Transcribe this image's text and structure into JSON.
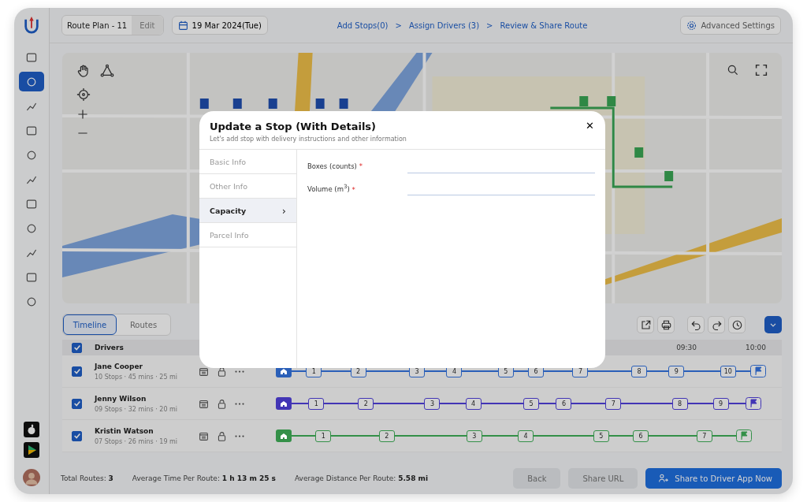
{
  "top_bar": {
    "route_plan": "Route Plan - 11",
    "edit": "Edit",
    "date": "19 Mar 2024(Tue)",
    "steps": [
      {
        "label": "Add Stops(0)",
        "separator": ">"
      },
      {
        "label": "Assign Drivers (3)",
        "separator": ">"
      },
      {
        "label": "Review & Share Route"
      }
    ],
    "advanced": "Advanced Settings"
  },
  "sidebar": {
    "items": [
      {
        "selected": false
      },
      {
        "selected": true
      },
      {
        "selected": false
      },
      {
        "selected": false
      },
      {
        "selected": false
      },
      {
        "selected": false
      },
      {
        "selected": false
      },
      {
        "selected": false
      },
      {
        "selected": false
      },
      {
        "selected": false
      },
      {
        "selected": false
      }
    ]
  },
  "map": {
    "kind": "picture"
  },
  "view_tabs": [
    {
      "label": "Timeline",
      "selected": true
    },
    {
      "label": "Routes",
      "selected": false
    }
  ],
  "drivers_header": {
    "label": "Drivers",
    "checked": true
  },
  "time_labels": [
    "09:30",
    "10:00"
  ],
  "drivers": [
    {
      "name": "Jane Cooper",
      "summary": "10 Stops  · 45 mins  · 25 mi",
      "checked": true,
      "color": "#2a5fb8",
      "stops": [
        "1",
        "2",
        "3",
        "4",
        "5",
        "6",
        "7",
        "8",
        "9",
        "10"
      ]
    },
    {
      "name": "Jenny Wilson",
      "summary": "09 Stops  · 32 mins  · 20 mi",
      "checked": true,
      "color": "#4235b5",
      "stops": [
        "1",
        "2",
        "3",
        "4",
        "5",
        "6",
        "7",
        "8",
        "9"
      ]
    },
    {
      "name": "Kristin Watson",
      "summary": "07 Stops  · 26 mins  · 19 mi",
      "checked": true,
      "color": "#349048",
      "stops": [
        "1",
        "2",
        "3",
        "4",
        "5",
        "6",
        "7"
      ]
    }
  ],
  "footer": {
    "stats": [
      {
        "label": "Total Routes:",
        "value": "3"
      },
      {
        "label": "Average Time Per Route:",
        "value": "1 h 13 m 25 s"
      },
      {
        "label": "Average Distance Per Route:",
        "value": "5.58 mi"
      }
    ],
    "buttons": [
      {
        "label": "Back",
        "kind": "secondary"
      },
      {
        "label": "Share URL",
        "kind": "secondary"
      },
      {
        "label": "Share to Driver App Now",
        "kind": "primary"
      }
    ]
  },
  "modal": {
    "title": "Update a Stop (With Details)",
    "subtitle": "Let's add stop with delivery instructions and other information",
    "close": "✕",
    "sections": [
      {
        "label": "Basic Info",
        "selected": false
      },
      {
        "label": "Other Info",
        "selected": false
      },
      {
        "label": "Capacity",
        "selected": true,
        "arrow": "›"
      },
      {
        "label": "Parcel Info",
        "selected": false
      }
    ],
    "fields": [
      {
        "label": "Boxes (counts)",
        "marker": "*"
      },
      {
        "label": "Volume (m$^{3}$)",
        "marker": "*"
      }
    ]
  }
}
